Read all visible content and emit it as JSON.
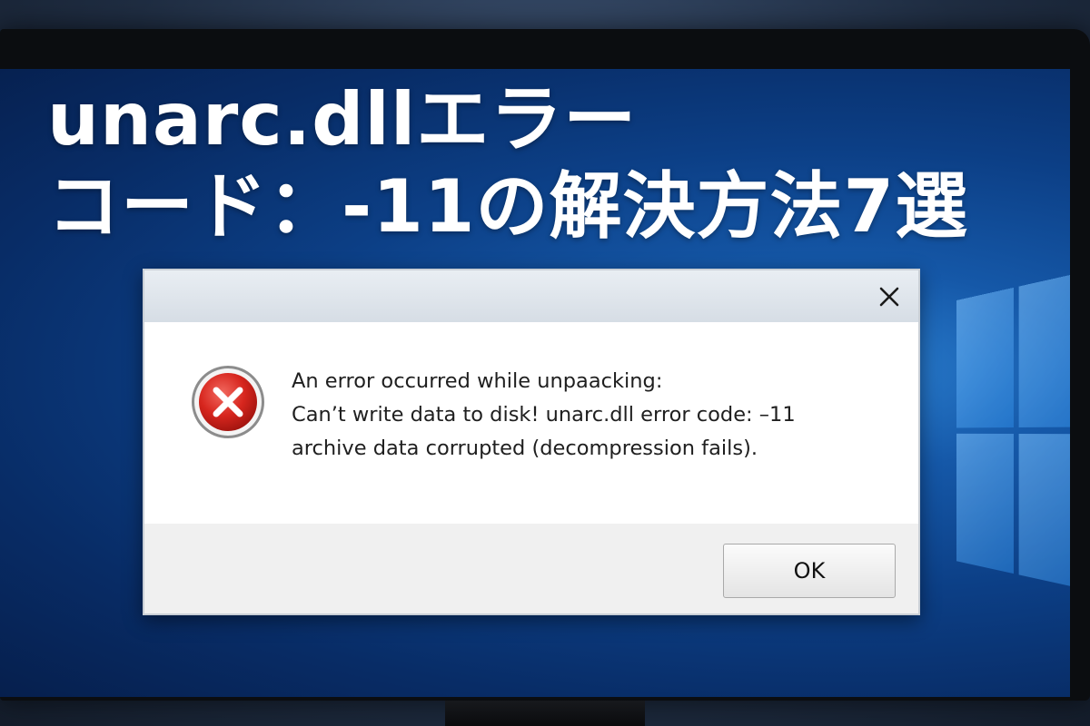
{
  "headline": {
    "line1": "unarc.dllエラー",
    "line2": "コード：-11の解決方法7選"
  },
  "dialog": {
    "close_icon": "close-icon",
    "error_icon": "error-icon",
    "message_lines": [
      "An error occurred while unpaacking:",
      "Can’t write data to disk! unarc.dll error code: –11",
      "archive data corrupted (decompression fails)."
    ],
    "ok_label": "OK"
  },
  "colors": {
    "desktop_blue": "#0c3f86",
    "error_red": "#d32f2f",
    "titlebar": "#dfe5ec",
    "footer": "#f0f0f0"
  }
}
